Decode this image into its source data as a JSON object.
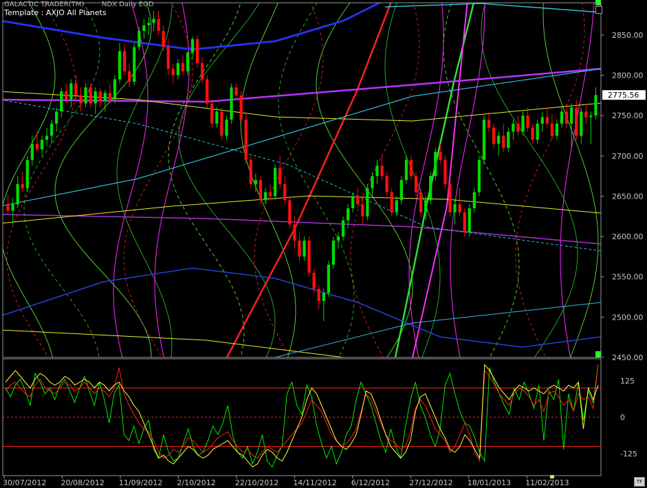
{
  "header": {
    "app_title": "GALACTIC TRADER(TM)",
    "symbol": "NDX Daily EOD",
    "template": "Template : AXJO All Planets",
    "tf_label": "TF"
  },
  "colors": {
    "background": "#000000",
    "up_candle": "#00dd00",
    "down_candle": "#ff1010",
    "axis_text": "#c8c8c8",
    "last_price_bg": "#ffffff"
  },
  "chart_data": [
    {
      "type": "candlestick",
      "title": "",
      "ylim": [
        2450,
        2890
      ],
      "ytick_labels": [
        "2450.00",
        "2500.00",
        "2550.00",
        "2600.00",
        "2650.00",
        "2700.00",
        "2750.00",
        "2800.00",
        "2850.00"
      ],
      "last_price_label": "2775.56",
      "last_price": 2775.56,
      "x_date_labels": [
        "30/07/2012",
        "20/08/2012",
        "11/09/2012",
        "2/10/2012",
        "22/10/2012",
        "14/11/2012",
        "6/12/2012",
        "27/12/2012",
        "18/01/2013",
        "11/02/2013"
      ],
      "ohlc": [
        [
          2640,
          2652,
          2628,
          2632
        ],
        [
          2632,
          2648,
          2615,
          2640
        ],
        [
          2640,
          2675,
          2635,
          2665
        ],
        [
          2665,
          2680,
          2655,
          2660
        ],
        [
          2660,
          2700,
          2655,
          2695
        ],
        [
          2695,
          2725,
          2688,
          2715
        ],
        [
          2715,
          2730,
          2705,
          2708
        ],
        [
          2708,
          2725,
          2700,
          2720
        ],
        [
          2720,
          2735,
          2712,
          2725
        ],
        [
          2725,
          2745,
          2715,
          2740
        ],
        [
          2740,
          2760,
          2730,
          2755
        ],
        [
          2755,
          2785,
          2748,
          2780
        ],
        [
          2780,
          2790,
          2765,
          2770
        ],
        [
          2770,
          2795,
          2760,
          2790
        ],
        [
          2790,
          2800,
          2770,
          2775
        ],
        [
          2775,
          2785,
          2755,
          2765
        ],
        [
          2765,
          2790,
          2760,
          2785
        ],
        [
          2785,
          2790,
          2760,
          2765
        ],
        [
          2765,
          2785,
          2752,
          2780
        ],
        [
          2780,
          2785,
          2760,
          2768
        ],
        [
          2768,
          2782,
          2755,
          2778
        ],
        [
          2778,
          2790,
          2765,
          2770
        ],
        [
          2770,
          2800,
          2765,
          2795
        ],
        [
          2795,
          2840,
          2790,
          2830
        ],
        [
          2830,
          2840,
          2800,
          2805
        ],
        [
          2805,
          2815,
          2785,
          2792
        ],
        [
          2792,
          2840,
          2788,
          2835
        ],
        [
          2835,
          2860,
          2830,
          2855
        ],
        [
          2855,
          2870,
          2845,
          2862
        ],
        [
          2862,
          2872,
          2850,
          2865
        ],
        [
          2865,
          2880,
          2855,
          2870
        ],
        [
          2870,
          2880,
          2850,
          2855
        ],
        [
          2855,
          2862,
          2830,
          2835
        ],
        [
          2835,
          2845,
          2800,
          2808
        ],
        [
          2808,
          2815,
          2790,
          2800
        ],
        [
          2800,
          2820,
          2795,
          2815
        ],
        [
          2815,
          2825,
          2800,
          2805
        ],
        [
          2805,
          2830,
          2800,
          2828
        ],
        [
          2828,
          2848,
          2820,
          2845
        ],
        [
          2845,
          2850,
          2810,
          2815
        ],
        [
          2815,
          2822,
          2790,
          2795
        ],
        [
          2795,
          2800,
          2760,
          2765
        ],
        [
          2765,
          2770,
          2735,
          2740
        ],
        [
          2740,
          2760,
          2735,
          2755
        ],
        [
          2755,
          2760,
          2720,
          2725
        ],
        [
          2725,
          2750,
          2720,
          2745
        ],
        [
          2745,
          2790,
          2740,
          2785
        ],
        [
          2785,
          2790,
          2770,
          2775
        ],
        [
          2775,
          2780,
          2740,
          2745
        ],
        [
          2745,
          2752,
          2690,
          2695
        ],
        [
          2695,
          2700,
          2660,
          2665
        ],
        [
          2665,
          2678,
          2655,
          2670
        ],
        [
          2670,
          2675,
          2640,
          2645
        ],
        [
          2645,
          2660,
          2640,
          2655
        ],
        [
          2655,
          2665,
          2645,
          2650
        ],
        [
          2650,
          2690,
          2645,
          2685
        ],
        [
          2685,
          2700,
          2660,
          2665
        ],
        [
          2665,
          2675,
          2640,
          2645
        ],
        [
          2645,
          2650,
          2610,
          2615
        ],
        [
          2615,
          2625,
          2585,
          2595
        ],
        [
          2595,
          2605,
          2570,
          2575
        ],
        [
          2575,
          2600,
          2570,
          2595
        ],
        [
          2595,
          2600,
          2550,
          2555
        ],
        [
          2555,
          2560,
          2530,
          2535
        ],
        [
          2535,
          2540,
          2510,
          2520
        ],
        [
          2520,
          2535,
          2495,
          2530
        ],
        [
          2530,
          2570,
          2525,
          2565
        ],
        [
          2565,
          2600,
          2560,
          2595
        ],
        [
          2595,
          2605,
          2585,
          2600
        ],
        [
          2600,
          2625,
          2595,
          2620
        ],
        [
          2620,
          2640,
          2610,
          2635
        ],
        [
          2635,
          2655,
          2630,
          2650
        ],
        [
          2650,
          2660,
          2635,
          2640
        ],
        [
          2640,
          2650,
          2615,
          2625
        ],
        [
          2625,
          2665,
          2620,
          2660
        ],
        [
          2660,
          2680,
          2650,
          2675
        ],
        [
          2675,
          2695,
          2665,
          2688
        ],
        [
          2688,
          2700,
          2670,
          2675
        ],
        [
          2675,
          2680,
          2650,
          2655
        ],
        [
          2655,
          2660,
          2625,
          2630
        ],
        [
          2630,
          2650,
          2625,
          2645
        ],
        [
          2645,
          2675,
          2640,
          2670
        ],
        [
          2670,
          2700,
          2665,
          2695
        ],
        [
          2695,
          2700,
          2670,
          2675
        ],
        [
          2675,
          2680,
          2650,
          2655
        ],
        [
          2655,
          2660,
          2625,
          2630
        ],
        [
          2630,
          2650,
          2620,
          2645
        ],
        [
          2645,
          2680,
          2640,
          2675
        ],
        [
          2675,
          2710,
          2670,
          2705
        ],
        [
          2705,
          2715,
          2690,
          2695
        ],
        [
          2695,
          2700,
          2660,
          2665
        ],
        [
          2665,
          2668,
          2625,
          2630
        ],
        [
          2630,
          2645,
          2615,
          2640
        ],
        [
          2640,
          2660,
          2625,
          2630
        ],
        [
          2630,
          2635,
          2600,
          2605
        ],
        [
          2605,
          2640,
          2600,
          2635
        ],
        [
          2635,
          2660,
          2630,
          2655
        ],
        [
          2655,
          2700,
          2650,
          2695
        ],
        [
          2695,
          2750,
          2690,
          2745
        ],
        [
          2745,
          2755,
          2730,
          2735
        ],
        [
          2735,
          2740,
          2710,
          2715
        ],
        [
          2715,
          2730,
          2700,
          2725
        ],
        [
          2725,
          2740,
          2705,
          2710
        ],
        [
          2710,
          2735,
          2705,
          2730
        ],
        [
          2730,
          2745,
          2720,
          2740
        ],
        [
          2740,
          2750,
          2725,
          2730
        ],
        [
          2730,
          2755,
          2725,
          2750
        ],
        [
          2750,
          2760,
          2730,
          2735
        ],
        [
          2735,
          2740,
          2715,
          2720
        ],
        [
          2720,
          2745,
          2715,
          2740
        ],
        [
          2740,
          2755,
          2730,
          2748
        ],
        [
          2748,
          2760,
          2735,
          2740
        ],
        [
          2740,
          2752,
          2720,
          2725
        ],
        [
          2725,
          2745,
          2720,
          2740
        ],
        [
          2740,
          2760,
          2735,
          2755
        ],
        [
          2755,
          2765,
          2735,
          2740
        ],
        [
          2740,
          2765,
          2710,
          2760
        ],
        [
          2760,
          2770,
          2720,
          2725
        ],
        [
          2725,
          2760,
          2715,
          2755
        ],
        [
          2755,
          2765,
          2740,
          2748
        ],
        [
          2748,
          2755,
          2715,
          2750
        ],
        [
          2750,
          2785,
          2745,
          2775.56
        ]
      ]
    },
    {
      "type": "line",
      "title": "",
      "ylim": [
        -200,
        200
      ],
      "ytick_labels": [
        "125",
        "0",
        "-125"
      ],
      "yticks": [
        125,
        0,
        -125
      ],
      "series": [
        {
          "color": "#00ee00",
          "values": [
            100,
            70,
            110,
            130,
            90,
            40,
            150,
            120,
            80,
            100,
            60,
            110,
            130,
            90,
            50,
            100,
            140,
            90,
            40,
            120,
            60,
            -20,
            80,
            110,
            -60,
            -80,
            -30,
            -90,
            -40,
            -10,
            -110,
            -140,
            -60,
            -120,
            -150,
            -140,
            -90,
            -40,
            -100,
            -130,
            -120,
            -80,
            -30,
            -60,
            -20,
            40,
            -60,
            -120,
            -140,
            -100,
            -160,
            -120,
            -60,
            -150,
            -170,
            -130,
            -100,
            80,
            120,
            40,
            10,
            110,
            70,
            -30,
            -90,
            -140,
            -100,
            -160,
            -120,
            -60,
            -30,
            60,
            120,
            80,
            40,
            -20,
            -80,
            -120,
            -40,
            -100,
            -140,
            -30,
            60,
            120,
            40,
            0,
            -60,
            -100,
            -40,
            110,
            150,
            80,
            20,
            -20,
            -30,
            -70,
            -120,
            -150,
            170,
            120,
            80,
            40,
            10,
            100,
            60,
            120,
            80,
            30,
            110,
            -80,
            90,
            60,
            130,
            -110,
            80,
            20,
            120,
            -10,
            90,
            50,
            180
          ]
        },
        {
          "color": "#ff2020",
          "values": [
            90,
            110,
            120,
            100,
            80,
            70,
            110,
            130,
            100,
            90,
            80,
            100,
            120,
            110,
            90,
            100,
            120,
            100,
            80,
            100,
            90,
            70,
            100,
            170,
            80,
            40,
            10,
            -20,
            -40,
            -50,
            -80,
            -120,
            -140,
            -130,
            -110,
            -120,
            -100,
            -70,
            -80,
            -100,
            -120,
            -110,
            -90,
            -70,
            -60,
            -50,
            -80,
            -100,
            -120,
            -110,
            -130,
            -140,
            -120,
            -100,
            -110,
            -120,
            -100,
            -80,
            -60,
            -40,
            -20,
            20,
            60,
            40,
            20,
            -20,
            -60,
            -80,
            -100,
            -90,
            -70,
            -40,
            20,
            80,
            60,
            20,
            -20,
            -60,
            -80,
            -90,
            -110,
            -100,
            -50,
            30,
            60,
            40,
            0,
            -40,
            -60,
            -80,
            -120,
            -100,
            -60,
            -20,
            -60,
            -120,
            -150,
            160,
            140,
            110,
            80,
            60,
            40,
            80,
            100,
            90,
            70,
            40,
            60,
            20,
            80,
            90,
            70,
            40,
            60,
            20,
            80,
            60,
            70,
            30,
            180
          ]
        },
        {
          "color": "#ffff40",
          "values": [
            120,
            140,
            160,
            140,
            120,
            100,
            130,
            150,
            140,
            120,
            110,
            120,
            140,
            130,
            110,
            120,
            130,
            120,
            100,
            120,
            110,
            90,
            110,
            120,
            90,
            70,
            40,
            20,
            -20,
            -60,
            -100,
            -140,
            -130,
            -150,
            -160,
            -140,
            -120,
            -100,
            -110,
            -130,
            -140,
            -130,
            -110,
            -100,
            -90,
            -80,
            -100,
            -120,
            -130,
            -150,
            -170,
            -160,
            -130,
            -110,
            -120,
            -140,
            -150,
            -120,
            -80,
            -40,
            0,
            60,
            100,
            80,
            40,
            0,
            -40,
            -80,
            -100,
            -110,
            -90,
            -60,
            10,
            90,
            80,
            40,
            -10,
            -60,
            -100,
            -120,
            -140,
            -120,
            -80,
            20,
            70,
            80,
            40,
            0,
            -40,
            -70,
            -110,
            -120,
            -100,
            -60,
            -80,
            -110,
            -140,
            180,
            160,
            130,
            100,
            80,
            60,
            90,
            110,
            100,
            90,
            100,
            90,
            80,
            100,
            110,
            100,
            90,
            110,
            100,
            120,
            -40,
            100,
            60,
            110
          ]
        }
      ],
      "hlines": [
        100,
        0,
        -100
      ]
    }
  ]
}
